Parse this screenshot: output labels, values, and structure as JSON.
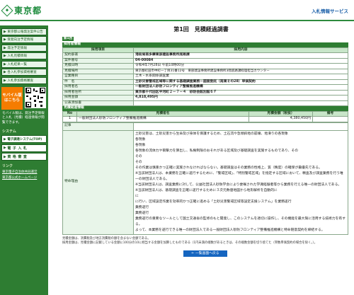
{
  "header": {
    "logo_text": "東京都",
    "site_title": "入札情報サービス"
  },
  "sidebar": {
    "buttons": [
      "東京都公報発注案件公告",
      "受発向注予定情報",
      "発注予定情報",
      "入札見積情報",
      "入札結果一覧",
      "各入札参加資格審査",
      "入札参加資格審査"
    ],
    "mobile_label": "モバイル版\nはこちら",
    "mobile_note": "モバイル版は、発注予定情報と入札（見積）経過情報が閲覧できます。",
    "systems_label": "システム",
    "systems": [
      "電子調達システム(TOP)",
      "電子入札",
      "資格審査"
    ],
    "links_label": "リンク",
    "links": [
      "東京電子自治体共同運営",
      "東京都公式ホームページ"
    ]
  },
  "page": {
    "title": "第1回　見積経過調書",
    "tab": "第1回"
  },
  "tender_info": {
    "section_title": "採用者情報",
    "col_item": "採用項目",
    "col_content": "採用内容",
    "rows": [
      {
        "label": "契約部署",
        "value": "港段局南多摩東部建設事務所底路課",
        "bold": true
      },
      {
        "label": "案件番号",
        "value": "04-00084",
        "bold": true
      },
      {
        "label": "見積日時",
        "value": "令和4年7月28日 午前10時00分",
        "bold": false
      },
      {
        "label": "見積場所",
        "value": "東京都町田市中町一丁目31番12号　東部建設事務所建設事務所3階底路課経理担当カウンター",
        "bold": false
      },
      {
        "label": "営業種目",
        "value": "土木・水系関係調査業",
        "bold": false
      },
      {
        "label": "件　名",
        "value": "土砂災害警戒区域等に関する基礎調査業務－図面委託（南東その28）単価契約",
        "bold": true
      },
      {
        "label": "採用者名",
        "value": "一般財団法人砂防フロンティア整備推進機構",
        "bold": true
      },
      {
        "label": "採用者住所",
        "value": "東京都千代田区平河町２－７－４　砂防会館別館６Ｆ",
        "bold": true
      },
      {
        "label": "採用金額",
        "value": "4,818,495円",
        "bold": true
      },
      {
        "label": "公表添加書",
        "value": "",
        "bold": false
      }
    ]
  },
  "bid_info": {
    "section_title": "見積経過情報",
    "columns": [
      "No",
      "見積者名",
      "見積金額（税抜）",
      "備考"
    ],
    "rows": [
      {
        "no": "1",
        "name": "一般財団法人砂防フロンティア整備推進機構",
        "amount": "4,380,450円",
        "note": ""
      }
    ],
    "remarks_label": "記事",
    "reason_label": "特命理由",
    "reason_lines": [
      "土砂災害は、土砂災害から生命及び身体を保護するため、土石流や急傾斜地の崩壊、地滑りの各現象",
      "各現象",
      "各現象",
      "各現象の流体力や衝撃力を算出し、私権制限のおそれがある区域及び基礎調査を実施するものであり、その",
      "その",
      "その",
      "その作業は慎重かつ正確に実施されなければならない。基礎調査はその業務の性格上、質（精度）の確保が最優先である。",
      "※当該財団法人は、本業務を正確に遂行するために、「警戒区域」、「特別警戒区域」を指定する区域において、精査及び調査業務を行う唯一の財団法人である。",
      "※当該財団法人は、調査業務に対して、公益社団法人砂防学会により委嘱された学識経験者等から業務を行える唯一の財団法人である。",
      "※当該財団法人は、基礎調査を正確に遂行するために３次元数値地図から地形解析を自動的に",
      "に",
      "に行い、区域設定作業を効率的かつ正確に進める「土砂災害警戒区域等設定支援システム」を業務遂行",
      "業務遂行",
      "業務遂行",
      "業務遂行の重要なツールとして国土交通省の監修のもと開発し、このシステムを適切に操作し、その機能を最大限に活用する技術力を有する。",
      "よって、本業務を遂行できる唯一の財団法人である一般財団法人砂防フロンティア整備推進機構と特命随意契約を締結する。"
    ]
  },
  "footer": {
    "note1": "見積金額は、消費税及び地方消費税の額を含まない金額である。",
    "note2": "採用金額は、見積金額に記載している金額に100分の10に相当する金額を加算したものである（1円未満の端数があるときは、その端数金額を切り捨てた（単数単価契約の場合を除く。）。",
    "back_button": "← 一覧画面へ戻る"
  }
}
